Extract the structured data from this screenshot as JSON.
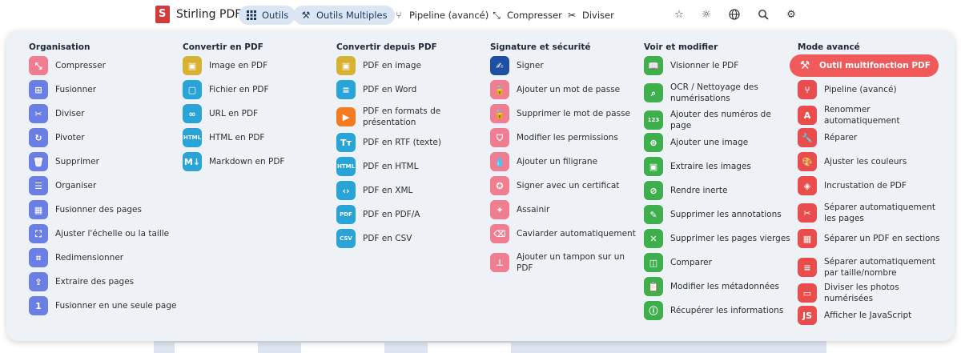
{
  "nav": {
    "brand": "Stirling PDF",
    "buttons": [
      {
        "label": "Outils",
        "icon": "grid-icon"
      },
      {
        "label": "Outils Multiples",
        "icon": "tools-icon"
      },
      {
        "label": "Pipeline (avancé)",
        "icon": "pipeline-icon"
      },
      {
        "label": "Compresser",
        "icon": "compress-icon"
      },
      {
        "label": "Diviser",
        "icon": "scissors-icon"
      }
    ]
  },
  "columns": [
    {
      "title": "Organisation",
      "items": [
        {
          "label": "Compresser",
          "color": "#ef7e93",
          "icon": "compress-icon",
          "glyph": "⤡"
        },
        {
          "label": "Fusionner",
          "color": "#6b7fe3",
          "icon": "merge-icon",
          "glyph": "⊞"
        },
        {
          "label": "Diviser",
          "color": "#6b7fe3",
          "icon": "scissors-icon",
          "glyph": "✂"
        },
        {
          "label": "Pivoter",
          "color": "#6b7fe3",
          "icon": "rotate-icon",
          "glyph": "↻"
        },
        {
          "label": "Supprimer",
          "color": "#6b7fe3",
          "icon": "trash-icon",
          "glyph": "🗑"
        },
        {
          "label": "Organiser",
          "color": "#6b7fe3",
          "icon": "list-icon",
          "glyph": "☰"
        },
        {
          "label": "Fusionner des pages",
          "color": "#6b7fe3",
          "icon": "dashboard-icon",
          "glyph": "▦"
        },
        {
          "label": "Ajuster l'échelle ou la taille",
          "color": "#6b7fe3",
          "icon": "fullscreen-icon",
          "glyph": "⛶"
        },
        {
          "label": "Redimensionner",
          "color": "#6b7fe3",
          "icon": "crop-icon",
          "glyph": "⌗"
        },
        {
          "label": "Extraire des pages",
          "color": "#6b7fe3",
          "icon": "upload-icon",
          "glyph": "⇪"
        },
        {
          "label": "Fusionner en une seule page",
          "color": "#6b7fe3",
          "icon": "single-page-icon",
          "glyph": "1"
        }
      ]
    },
    {
      "title": "Convertir en PDF",
      "items": [
        {
          "label": "Image en PDF",
          "color": "#d6b233",
          "icon": "image-icon",
          "glyph": "▣"
        },
        {
          "label": "Fichier en PDF",
          "color": "#2aa3d6",
          "icon": "file-icon",
          "glyph": "▢"
        },
        {
          "label": "URL en PDF",
          "color": "#2aa3d6",
          "icon": "link-icon",
          "glyph": "∞"
        },
        {
          "label": "HTML en PDF",
          "color": "#2aa3d6",
          "icon": "html-icon",
          "glyph": "HTML"
        },
        {
          "label": "Markdown en PDF",
          "color": "#2aa3d6",
          "icon": "markdown-icon",
          "glyph": "M↓"
        }
      ]
    },
    {
      "title": "Convertir depuis PDF",
      "items": [
        {
          "label": "PDF en image",
          "color": "#d6b233",
          "icon": "image-icon",
          "glyph": "▣"
        },
        {
          "label": "PDF en Word",
          "color": "#2aa3d6",
          "icon": "word-icon",
          "glyph": "≡"
        },
        {
          "label": "PDF en formats de présentation",
          "color": "#f47b20",
          "icon": "presentation-icon",
          "glyph": "▶"
        },
        {
          "label": "PDF en RTF (texte)",
          "color": "#2aa3d6",
          "icon": "text-icon",
          "glyph": "Tт"
        },
        {
          "label": "PDF en HTML",
          "color": "#2aa3d6",
          "icon": "html-icon",
          "glyph": "HTML"
        },
        {
          "label": "PDF en XML",
          "color": "#2aa3d6",
          "icon": "code-icon",
          "glyph": "‹›"
        },
        {
          "label": "PDF en PDF/A",
          "color": "#2aa3d6",
          "icon": "pdfa-icon",
          "glyph": "PDF"
        },
        {
          "label": "PDF en CSV",
          "color": "#2aa3d6",
          "icon": "csv-icon",
          "glyph": "CSV"
        }
      ]
    },
    {
      "title": "Signature et sécurité",
      "items": [
        {
          "label": "Signer",
          "color": "#1f4fa3",
          "icon": "signature-icon",
          "glyph": "✍"
        },
        {
          "label": "Ajouter un mot de passe",
          "color": "#ef7e93",
          "icon": "lock-icon",
          "glyph": "🔒"
        },
        {
          "label": "Supprimer le mot de passe",
          "color": "#ef7e93",
          "icon": "unlock-icon",
          "glyph": "🔓"
        },
        {
          "label": "Modifier les permissions",
          "color": "#ef7e93",
          "icon": "shield-icon",
          "glyph": "⛉"
        },
        {
          "label": "Ajouter un filigrane",
          "color": "#ef7e93",
          "icon": "droplet-icon",
          "glyph": "💧"
        },
        {
          "label": "Signer avec un certificat",
          "color": "#ef7e93",
          "icon": "certificate-icon",
          "glyph": "✪"
        },
        {
          "label": "Assainir",
          "color": "#ef7e93",
          "icon": "sanitize-icon",
          "glyph": "✦"
        },
        {
          "label": "Caviarder automatiquement",
          "color": "#ef7e93",
          "icon": "eraser-icon",
          "glyph": "⌫"
        },
        {
          "label": "Ajouter un tampon sur un PDF",
          "color": "#ef7e93",
          "icon": "stamp-icon",
          "glyph": "⊥"
        }
      ]
    },
    {
      "title": "Voir et modifier",
      "items": [
        {
          "label": "Visionner le PDF",
          "color": "#3fae4d",
          "icon": "book-icon",
          "glyph": "📖"
        },
        {
          "label": "OCR / Nettoyage des numérisations",
          "color": "#3fae4d",
          "icon": "ocr-icon",
          "glyph": "⌕"
        },
        {
          "label": "Ajouter des numéros de page",
          "color": "#3fae4d",
          "icon": "numbers-icon",
          "glyph": "123"
        },
        {
          "label": "Ajouter une image",
          "color": "#3fae4d",
          "icon": "add-image-icon",
          "glyph": "⊕"
        },
        {
          "label": "Extraire les images",
          "color": "#3fae4d",
          "icon": "image-icon",
          "glyph": "▣"
        },
        {
          "label": "Rendre inerte",
          "color": "#3fae4d",
          "icon": "flatten-icon",
          "glyph": "⊘"
        },
        {
          "label": "Supprimer les annotations",
          "color": "#3fae4d",
          "icon": "annotation-icon",
          "glyph": "✎"
        },
        {
          "label": "Supprimer les pages vierges",
          "color": "#3fae4d",
          "icon": "blank-page-icon",
          "glyph": "✕"
        },
        {
          "label": "Comparer",
          "color": "#3fae4d",
          "icon": "compare-icon",
          "glyph": "◫"
        },
        {
          "label": "Modifier les métadonnées",
          "color": "#3fae4d",
          "icon": "clipboard-icon",
          "glyph": "📋"
        },
        {
          "label": "Récupérer les informations",
          "color": "#3fae4d",
          "icon": "info-icon",
          "glyph": "ⓘ"
        }
      ]
    },
    {
      "title": "Mode avancé",
      "items": [
        {
          "label": "Outil multifonction PDF",
          "color": "#f15a5a",
          "icon": "tools-icon",
          "glyph": "⚒",
          "highlight": true
        },
        {
          "label": "Pipeline (avancé)",
          "color": "#e84c4c",
          "icon": "pipeline-icon",
          "glyph": "⑂"
        },
        {
          "label": "Renommer automatiquement",
          "color": "#e84c4c",
          "icon": "rename-icon",
          "glyph": "A"
        },
        {
          "label": "Réparer",
          "color": "#e84c4c",
          "icon": "wrench-icon",
          "glyph": "🔧"
        },
        {
          "label": "Ajuster les couleurs",
          "color": "#e84c4c",
          "icon": "palette-icon",
          "glyph": "🎨"
        },
        {
          "label": "Incrustation de PDF",
          "color": "#e84c4c",
          "icon": "layers-icon",
          "glyph": "◈"
        },
        {
          "label": "Séparer automatiquement les pages",
          "color": "#e84c4c",
          "icon": "scissors-icon",
          "glyph": "✂"
        },
        {
          "label": "Séparer un PDF en sections",
          "color": "#e84c4c",
          "icon": "grid-icon",
          "glyph": "▦"
        },
        {
          "label": "Séparer automatiquement par taille/nombre",
          "color": "#e84c4c",
          "icon": "split-size-icon",
          "glyph": "≡"
        },
        {
          "label": "Diviser les photos numérisées",
          "color": "#e84c4c",
          "icon": "scanner-icon",
          "glyph": "▭"
        },
        {
          "label": "Afficher le JavaScript",
          "color": "#e84c4c",
          "icon": "javascript-icon",
          "glyph": "JS"
        }
      ]
    }
  ]
}
